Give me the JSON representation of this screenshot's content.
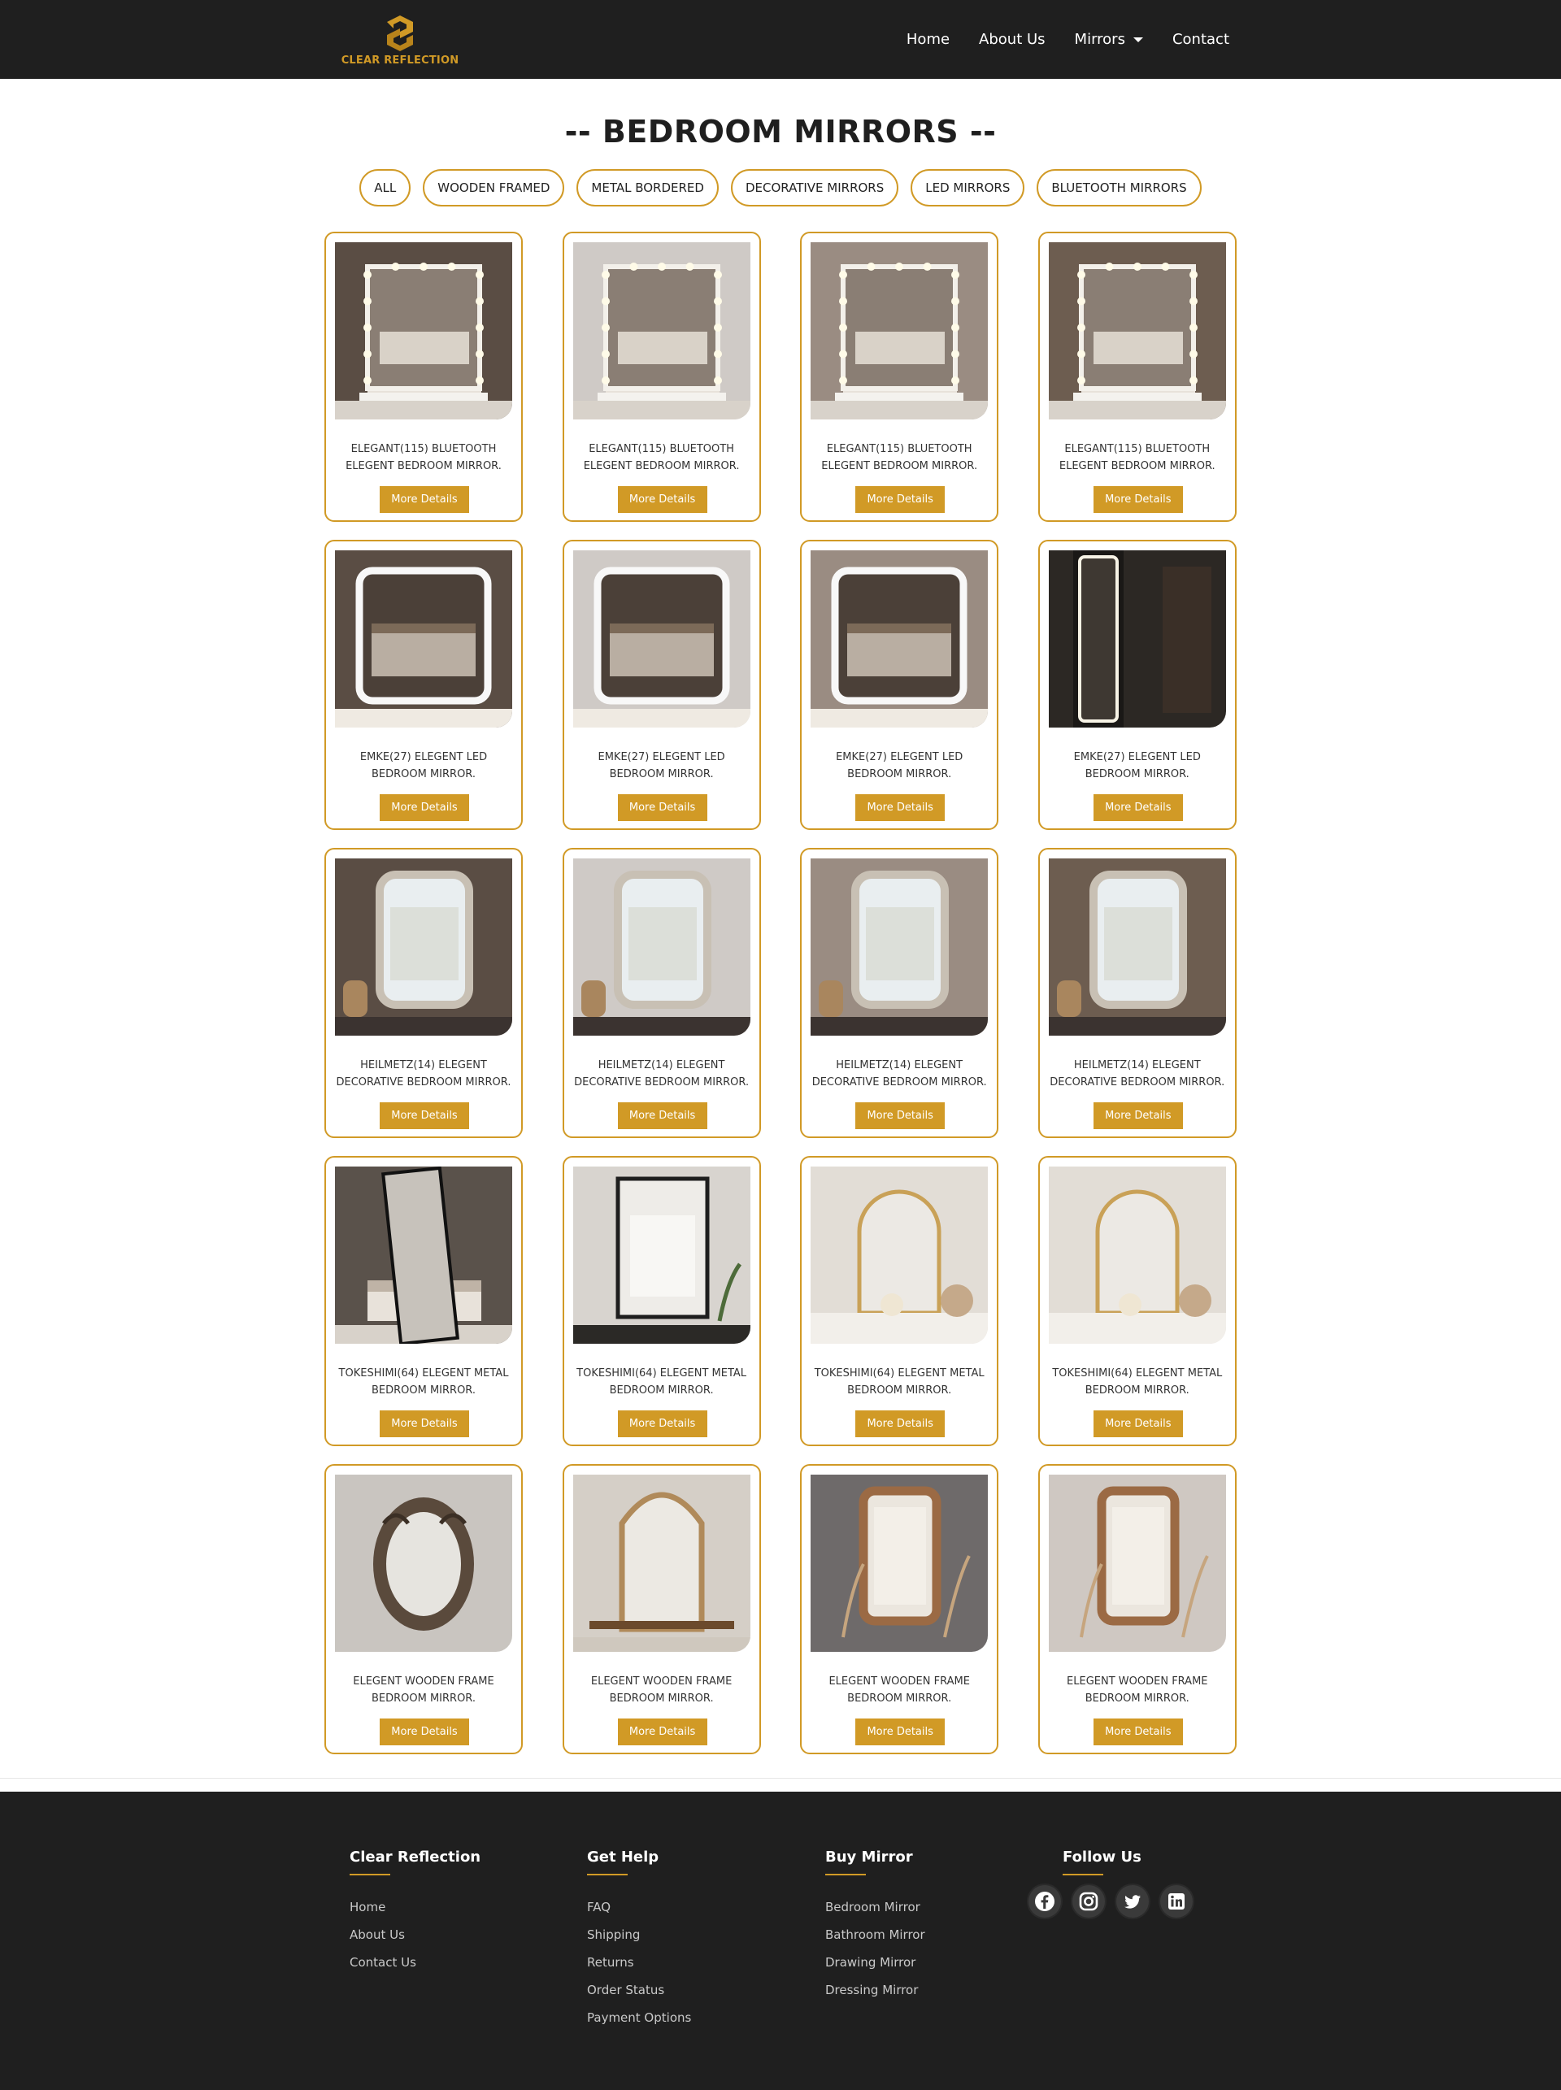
{
  "brand": {
    "name": "CLEAR REFLECTION",
    "accent": "#d19a26",
    "dark": "#1f1f1f"
  },
  "nav": {
    "items": [
      {
        "label": "Home"
      },
      {
        "label": "About Us"
      },
      {
        "label": "Mirrors",
        "dropdown": true
      },
      {
        "label": "Contact"
      }
    ]
  },
  "page": {
    "title": "-- BEDROOM MIRRORS --"
  },
  "filters": [
    "ALL",
    "WOODEN FRAMED",
    "METAL BORDERED",
    "DECORATIVE MIRRORS",
    "LED MIRRORS",
    "BLUETOOTH MIRRORS"
  ],
  "products": [
    {
      "name": "ELEGANT(115) BLUETOOTH ELEGENT BEDROOM MIRROR.",
      "button": "More Details",
      "image": "bluetooth-led-vanity-mirror"
    },
    {
      "name": "ELEGANT(115) BLUETOOTH ELEGENT BEDROOM MIRROR.",
      "button": "More Details",
      "image": "bluetooth-led-vanity-mirror"
    },
    {
      "name": "ELEGANT(115) BLUETOOTH ELEGENT BEDROOM MIRROR.",
      "button": "More Details",
      "image": "bluetooth-led-vanity-mirror"
    },
    {
      "name": "ELEGANT(115) BLUETOOTH ELEGENT BEDROOM MIRROR.",
      "button": "More Details",
      "image": "bluetooth-led-vanity-mirror"
    },
    {
      "name": "EMKE(27) ELEGENT LED BEDROOM MIRROR.",
      "button": "More Details",
      "image": "led-mirror"
    },
    {
      "name": "EMKE(27) ELEGENT LED BEDROOM MIRROR.",
      "button": "More Details",
      "image": "led-mirror"
    },
    {
      "name": "EMKE(27) ELEGENT LED BEDROOM MIRROR.",
      "button": "More Details",
      "image": "led-mirror"
    },
    {
      "name": "EMKE(27) ELEGENT LED BEDROOM MIRROR.",
      "button": "More Details",
      "image": "led-full-length-mirror"
    },
    {
      "name": "HEILMETZ(14) ELEGENT DECORATIVE BEDROOM MIRROR.",
      "button": "More Details",
      "image": "decorative-mirror"
    },
    {
      "name": "HEILMETZ(14) ELEGENT DECORATIVE BEDROOM MIRROR.",
      "button": "More Details",
      "image": "decorative-mirror"
    },
    {
      "name": "HEILMETZ(14) ELEGENT DECORATIVE BEDROOM MIRROR.",
      "button": "More Details",
      "image": "decorative-mirror"
    },
    {
      "name": "HEILMETZ(14) ELEGENT DECORATIVE BEDROOM MIRROR.",
      "button": "More Details",
      "image": "decorative-mirror"
    },
    {
      "name": "TOKESHIMI(64) ELEGENT METAL BEDROOM MIRROR.",
      "button": "More Details",
      "image": "metal-floor-mirror"
    },
    {
      "name": "TOKESHIMI(64) ELEGENT METAL BEDROOM MIRROR.",
      "button": "More Details",
      "image": "metal-mirror"
    },
    {
      "name": "TOKESHIMI(64) ELEGENT METAL BEDROOM MIRROR.",
      "button": "More Details",
      "image": "metal-arch-mirror"
    },
    {
      "name": "TOKESHIMI(64) ELEGENT METAL BEDROOM MIRROR.",
      "button": "More Details",
      "image": "metal-arch-mirror"
    },
    {
      "name": "ELEGENT WOODEN FRAME BEDROOM MIRROR.",
      "button": "More Details",
      "image": "wooden-oval-mirror"
    },
    {
      "name": "ELEGENT WOODEN FRAME BEDROOM MIRROR.",
      "button": "More Details",
      "image": "wooden-arch-mirror"
    },
    {
      "name": "ELEGENT WOODEN FRAME BEDROOM MIRROR.",
      "button": "More Details",
      "image": "wooden-ornate-mirror"
    },
    {
      "name": "ELEGENT WOODEN FRAME BEDROOM MIRROR.",
      "button": "More Details",
      "image": "wooden-ornate-mirror"
    }
  ],
  "footer": {
    "columns": [
      {
        "heading": "Clear Reflection",
        "links": [
          "Home",
          "About Us",
          "Contact Us"
        ]
      },
      {
        "heading": "Get Help",
        "links": [
          "FAQ",
          "Shipping",
          "Returns",
          "Order Status",
          "Payment Options"
        ]
      },
      {
        "heading": "Buy Mirror",
        "links": [
          "Bedroom Mirror",
          "Bathroom Mirror",
          "Drawing Mirror",
          "Dressing Mirror"
        ]
      },
      {
        "heading": "Follow Us",
        "links": []
      }
    ],
    "social": [
      "facebook-icon",
      "instagram-icon",
      "twitter-icon",
      "linkedin-icon"
    ]
  }
}
